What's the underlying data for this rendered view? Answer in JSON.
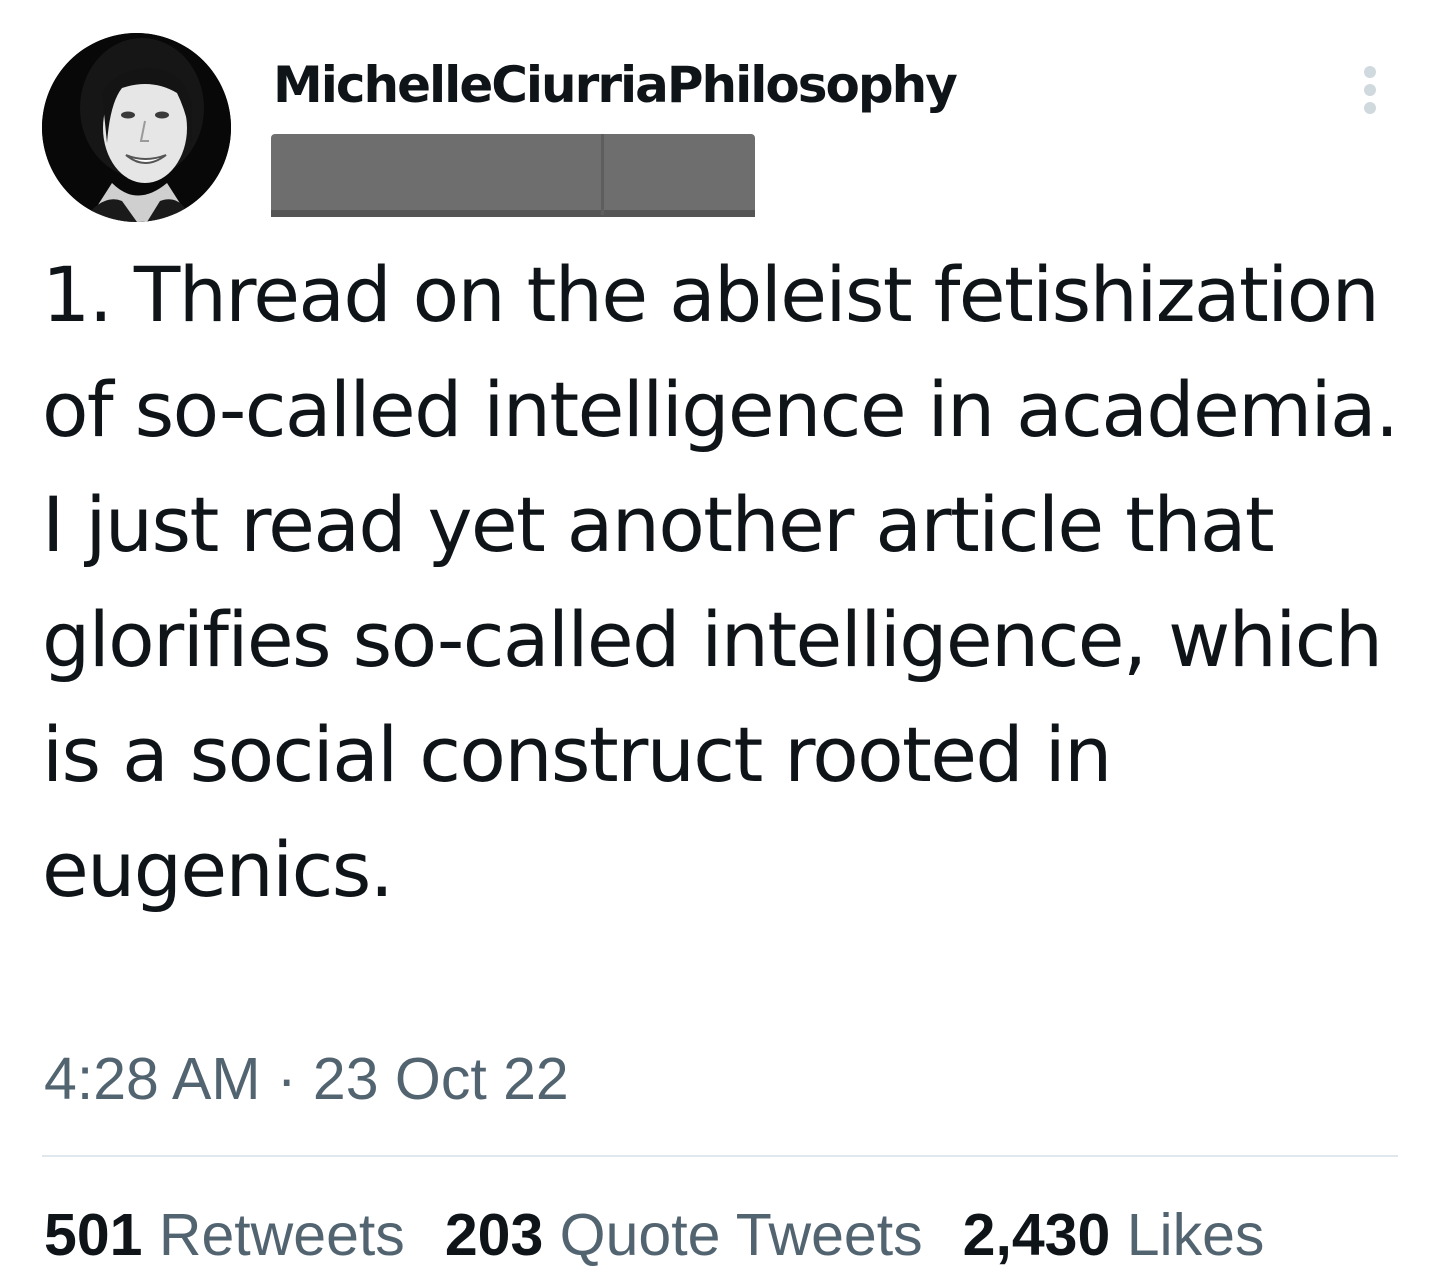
{
  "tweet": {
    "display_name": "MichelleCiurriaPhilosophy",
    "text": "1. Thread on the ableist fetishization of so-called intelligence in academia. I just read yet another article that glorifies so-called intelligence, which is a social construct rooted in eugenics.",
    "time": "4:28 AM",
    "separator": " · ",
    "date": "23 Oct 22"
  },
  "stats": {
    "retweets_count": "501",
    "retweets_label": "Retweets",
    "quotes_count": "203",
    "quotes_label": "Quote Tweets",
    "likes_count": "2,430",
    "likes_label": "Likes"
  },
  "icons": {
    "more": "more-vertical-icon",
    "avatar": "profile-photo"
  },
  "colors": {
    "text_primary": "#0f1419",
    "text_secondary": "#536471",
    "divider": "#e1e8ed",
    "redaction": "#6e6e6e"
  }
}
